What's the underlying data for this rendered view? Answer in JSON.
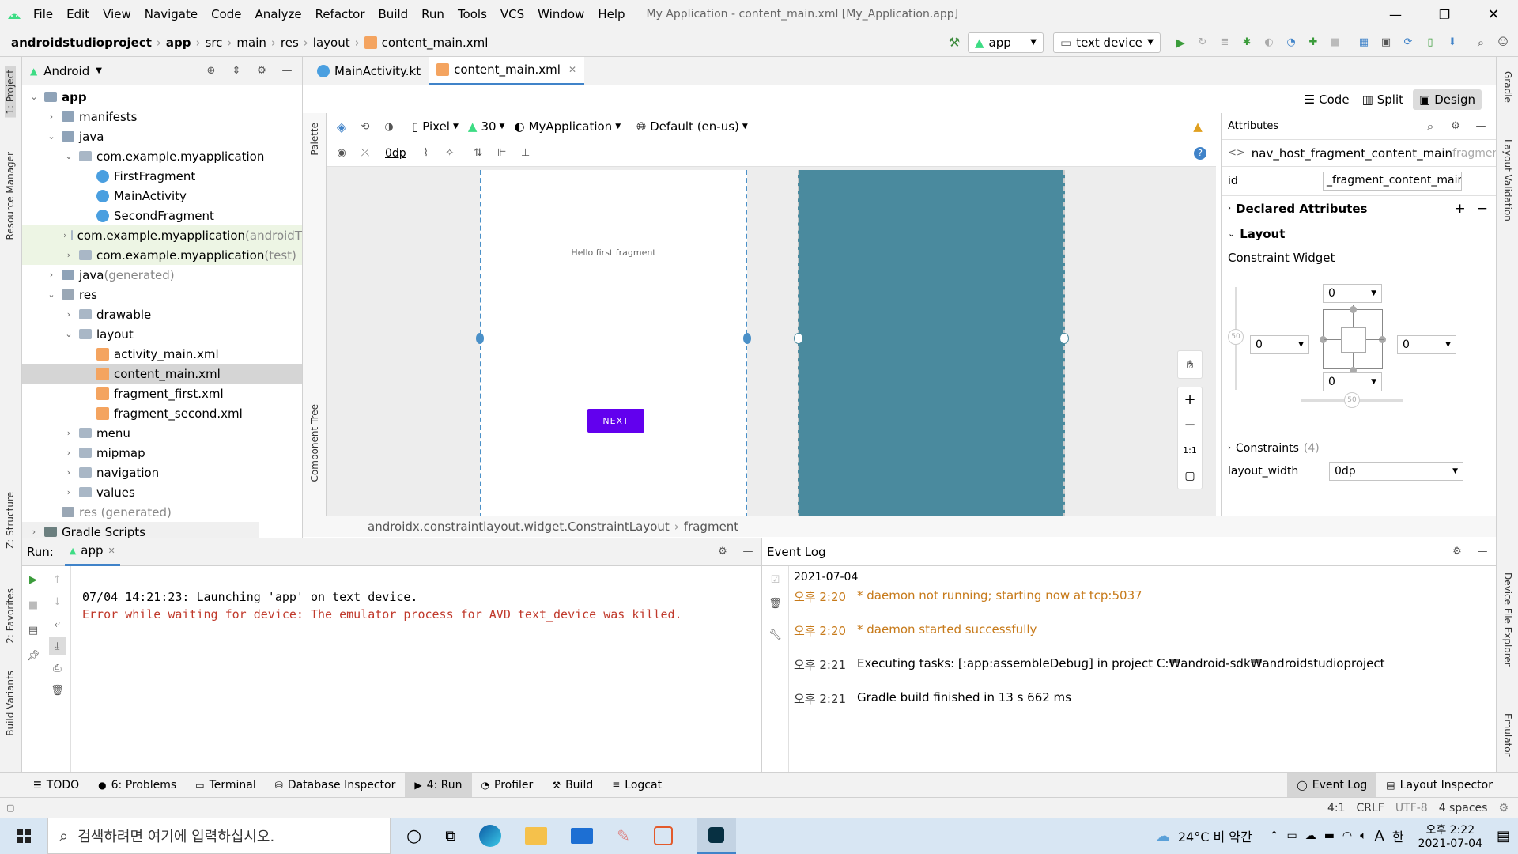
{
  "window": {
    "title": "My Application - content_main.xml [My_Application.app]",
    "menu": [
      "File",
      "Edit",
      "View",
      "Navigate",
      "Code",
      "Analyze",
      "Refactor",
      "Build",
      "Run",
      "Tools",
      "VCS",
      "Window",
      "Help"
    ]
  },
  "nav": {
    "breadcrumb": [
      "androidstudioproject",
      "app",
      "src",
      "main",
      "res",
      "layout",
      "content_main.xml"
    ],
    "run_config": "app",
    "device": "text device"
  },
  "project": {
    "view_mode": "Android",
    "tree": [
      {
        "label": "app",
        "depth": 0,
        "open": true,
        "type": "folder",
        "bold": true
      },
      {
        "label": "manifests",
        "depth": 1,
        "open": false,
        "type": "folder"
      },
      {
        "label": "java",
        "depth": 1,
        "open": true,
        "type": "folder"
      },
      {
        "label": "com.example.myapplication",
        "depth": 2,
        "open": true,
        "type": "pkg"
      },
      {
        "label": "FirstFragment",
        "depth": 3,
        "type": "kt"
      },
      {
        "label": "MainActivity",
        "depth": 3,
        "type": "kt"
      },
      {
        "label": "SecondFragment",
        "depth": 3,
        "type": "kt"
      },
      {
        "label": "com.example.myapplication",
        "suffix": " (androidT",
        "depth": 2,
        "open": false,
        "type": "pkg",
        "green": true
      },
      {
        "label": "com.example.myapplication",
        "suffix": " (test)",
        "depth": 2,
        "open": false,
        "type": "pkg",
        "green": true
      },
      {
        "label": "java",
        "suffix": " (generated)",
        "depth": 1,
        "open": false,
        "type": "folder"
      },
      {
        "label": "res",
        "depth": 1,
        "open": true,
        "type": "res"
      },
      {
        "label": "drawable",
        "depth": 2,
        "open": false,
        "type": "pkg"
      },
      {
        "label": "layout",
        "depth": 2,
        "open": true,
        "type": "pkg"
      },
      {
        "label": "activity_main.xml",
        "depth": 3,
        "type": "xml"
      },
      {
        "label": "content_main.xml",
        "depth": 3,
        "type": "xml",
        "selected": true
      },
      {
        "label": "fragment_first.xml",
        "depth": 3,
        "type": "xml"
      },
      {
        "label": "fragment_second.xml",
        "depth": 3,
        "type": "xml"
      },
      {
        "label": "menu",
        "depth": 2,
        "open": false,
        "type": "pkg"
      },
      {
        "label": "mipmap",
        "depth": 2,
        "open": false,
        "type": "pkg"
      },
      {
        "label": "navigation",
        "depth": 2,
        "open": false,
        "type": "pkg"
      },
      {
        "label": "values",
        "depth": 2,
        "open": false,
        "type": "pkg"
      },
      {
        "label": "res (generated)",
        "depth": 1,
        "type": "res",
        "gray": true
      },
      {
        "label": "Gradle Scripts",
        "depth": 0,
        "open": false,
        "type": "gradle"
      }
    ]
  },
  "left_strip": [
    "1: Project",
    "Resource Manager",
    "Z: Structure",
    "2: Favorites",
    "Build Variants"
  ],
  "right_strip": [
    "Gradle",
    "Layout Validation",
    "Device File Explorer",
    "Emulator"
  ],
  "tabs": [
    {
      "label": "MainActivity.kt",
      "active": false
    },
    {
      "label": "content_main.xml",
      "active": true
    }
  ],
  "view_modes": {
    "code": "Code",
    "split": "Split",
    "design": "Design"
  },
  "design_toolbar": {
    "device": "Pixel",
    "api": "30",
    "theme": "MyApplication",
    "locale": "Default (en-us)",
    "margin": "0dp"
  },
  "side_labels": {
    "palette": "Palette",
    "component_tree": "Component Tree"
  },
  "preview": {
    "text": "Hello first fragment",
    "button": "NEXT",
    "accent": "#6200ee",
    "blueprint_color": "#4a8a9e"
  },
  "zoom_controls": {
    "fit": "1:1"
  },
  "attributes": {
    "title": "Attributes",
    "component": "nav_host_fragment_content_main",
    "component_type": "fragment",
    "id_label": "id",
    "id_value": "_fragment_content_main",
    "declared": "Declared Attributes",
    "layout": "Layout",
    "constraint_widget": "Constraint Widget",
    "margins": {
      "top": "0",
      "left": "0",
      "right": "0",
      "bottom": "0"
    },
    "bias_v": "50",
    "bias_h": "50",
    "constraints": "Constraints",
    "constraints_count": "(4)",
    "layout_width_label": "layout_width",
    "layout_width_value": "0dp"
  },
  "breadcrumb_bottom": [
    "androidx.constraintlayout.widget.ConstraintLayout",
    "fragment"
  ],
  "run": {
    "label": "Run:",
    "tab": "app",
    "lines": [
      {
        "text": "07/04 14:21:23: Launching 'app' on text device.",
        "error": false
      },
      {
        "text": "Error while waiting for device: The emulator process for AVD text_device was killed.",
        "error": true
      }
    ]
  },
  "event_log": {
    "title": "Event Log",
    "date": "2021-07-04",
    "entries": [
      {
        "time": "오후 2:20",
        "text": "* daemon not running; starting now at tcp:5037",
        "warn": true
      },
      {
        "time": "오후 2:20",
        "text": "* daemon started successfully",
        "warn": true
      },
      {
        "time": "오후 2:21",
        "text": "Executing tasks: [:app:assembleDebug] in project C:₩android-sdk₩androidstudioproject",
        "warn": false
      },
      {
        "time": "오후 2:21",
        "text": "Gradle build finished in 13 s 662 ms",
        "warn": false
      }
    ]
  },
  "tool_windows": [
    {
      "label": "TODO",
      "active": false
    },
    {
      "label": "6: Problems",
      "active": false
    },
    {
      "label": "Terminal",
      "active": false
    },
    {
      "label": "Database Inspector",
      "active": false
    },
    {
      "label": "4: Run",
      "active": true
    },
    {
      "label": "Profiler",
      "active": false
    },
    {
      "label": "Build",
      "active": false
    },
    {
      "label": "Logcat",
      "active": false
    }
  ],
  "tool_windows_right": [
    {
      "label": "Event Log",
      "active": true
    },
    {
      "label": "Layout Inspector",
      "active": false
    }
  ],
  "status": {
    "position": "4:1",
    "line_sep": "CRLF",
    "encoding": "UTF-8",
    "indent": "4 spaces"
  },
  "taskbar": {
    "search_placeholder": "검색하려면 여기에 입력하십시오.",
    "weather": "24°C  비 약간",
    "ime": "한",
    "ime_a": "A",
    "time": "오후 2:22",
    "date": "2021-07-04"
  }
}
